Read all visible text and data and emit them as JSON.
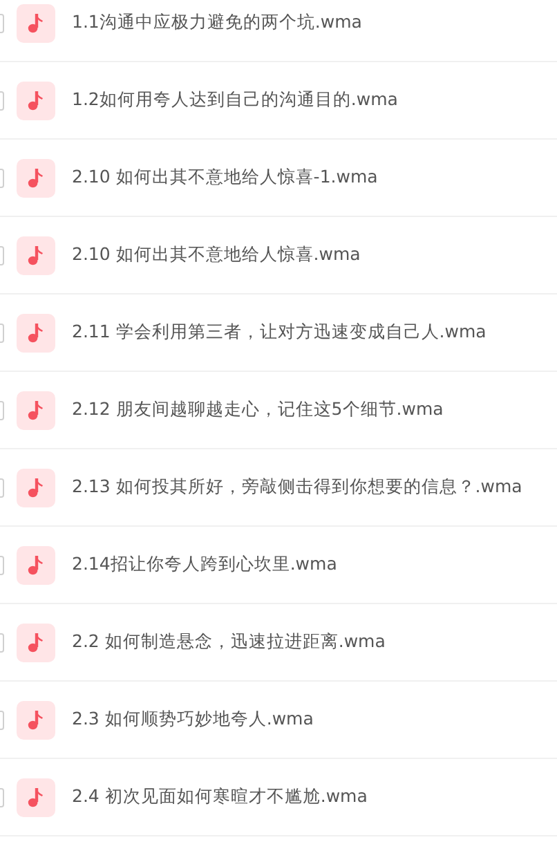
{
  "files": [
    {
      "name": "1.1沟通中应极力避免的两个坑.wma",
      "checked": false
    },
    {
      "name": "1.2如何用夸人达到自己的沟通目的.wma",
      "checked": false
    },
    {
      "name": "2.10 如何出其不意地给人惊喜-1.wma",
      "checked": false
    },
    {
      "name": "2.10 如何出其不意地给人惊喜.wma",
      "checked": false
    },
    {
      "name": "2.11 学会利用第三者，让对方迅速变成自己人.wma",
      "checked": false
    },
    {
      "name": "2.12 朋友间越聊越走心，记住这5个细节.wma",
      "checked": false
    },
    {
      "name": "2.13 如何投其所好，旁敲侧击得到你想要的信息？.wma",
      "checked": false
    },
    {
      "name": "2.14招让你夸人跨到心坎里.wma",
      "checked": false
    },
    {
      "name": "2.2 如何制造悬念，迅速拉进距离.wma",
      "checked": false
    },
    {
      "name": "2.3 如何顺势巧妙地夸人.wma",
      "checked": false
    },
    {
      "name": "2.4 初次见面如何寒暄才不尴尬.wma",
      "checked": false
    }
  ]
}
